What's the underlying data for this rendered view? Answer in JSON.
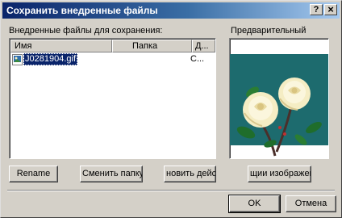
{
  "window": {
    "title": "Сохранить внедренные файлы",
    "help_button": "?",
    "close_button": "×"
  },
  "files_panel": {
    "label": "Внедренные файлы для сохранения:",
    "columns": [
      "Имя",
      "Папка",
      "Д..."
    ],
    "rows": [
      {
        "name": "J0281904.gif",
        "folder": "",
        "col3": "С..."
      }
    ]
  },
  "preview_panel": {
    "label": "Предварительный"
  },
  "action_buttons": {
    "rename": "Rename",
    "change_folder": "Сменить папку...",
    "new_action": "новить дейст",
    "image_options": "щии изображени"
  },
  "dialog_buttons": {
    "ok": "OK",
    "cancel": "Отмена"
  },
  "colors": {
    "selection": "#0a246a",
    "preview_bg": "#1d6b6e",
    "rose": "#f5edc4"
  },
  "icons": {
    "file": "gif-file-icon"
  }
}
